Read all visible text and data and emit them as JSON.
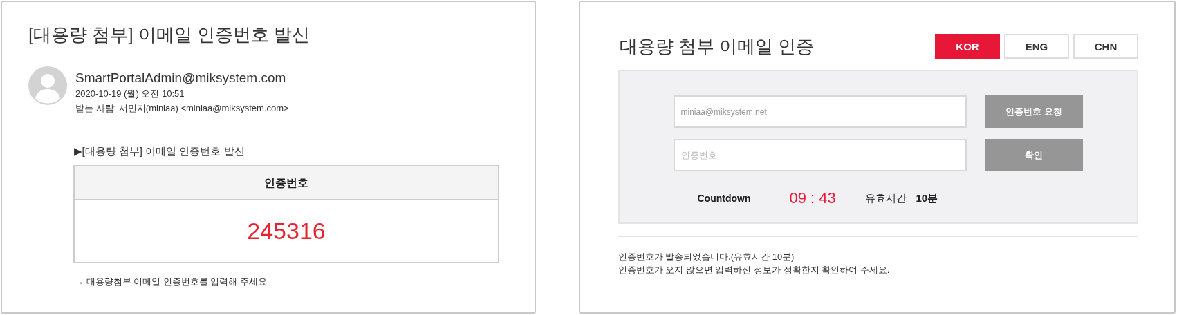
{
  "email_panel": {
    "subject": "[대용량 첨부] 이메일 인증번호 발신",
    "sender": "SmartPortalAdmin@miksystem.com",
    "date": "2020-10-19 (월) 오전 10:51",
    "recipient": "받는 사람: 서민지(miniaa) <miniaa@miksystem.com>",
    "body_heading": "▶[대용량 첨부] 이메일 인증번호 발신",
    "code_table": {
      "header": "인증번호",
      "code": "245316"
    },
    "instruction": "→ 대용량첨부 이메일 인증번호를 입력해 주세요"
  },
  "verify_panel": {
    "title": "대용량 첨부 이메일 인증",
    "languages": [
      {
        "label": "KOR",
        "selected": true
      },
      {
        "label": "ENG",
        "selected": false
      },
      {
        "label": "CHN",
        "selected": false
      }
    ],
    "email_field": {
      "value": "miniaa@miksystem.net"
    },
    "request_button": "인증번호 요청",
    "code_field": {
      "placeholder": "인증번호"
    },
    "confirm_button": "확인",
    "countdown_label": "Countdown",
    "countdown_time": "09 : 43",
    "validity_label": "유효시간",
    "validity_value": "10분",
    "notes": [
      "인증번호가 발송되었습니다.(유효시간 10분)",
      "인증번호가 오지 않으면 입력하신 정보가 정확한지 확인하여 주세요."
    ]
  }
}
